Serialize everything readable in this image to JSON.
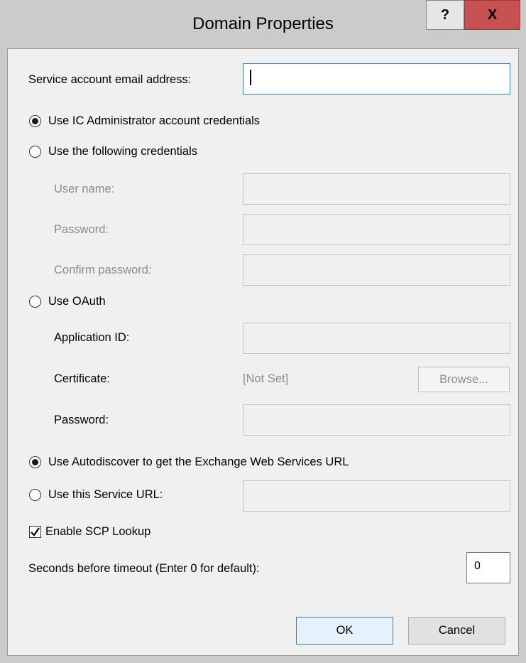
{
  "window": {
    "title": "Domain Properties",
    "help_label": "?",
    "close_label": "X"
  },
  "service_account": {
    "label": "Service account email address:",
    "value": ""
  },
  "credentials": {
    "ic_admin_label": "Use IC Administrator account credentials",
    "ic_admin_selected": true,
    "following_label": "Use the following credentials",
    "username_label": "User name:",
    "password_label": "Password:",
    "confirm_label": "Confirm password:"
  },
  "oauth": {
    "label": "Use OAuth",
    "app_id_label": "Application ID:",
    "certificate_label": "Certificate:",
    "certificate_value": "[Not Set]",
    "browse_label": "Browse...",
    "password_label": "Password:"
  },
  "ews": {
    "autodiscover_label": "Use Autodiscover to get the Exchange Web Services URL",
    "autodiscover_selected": true,
    "service_url_label": "Use this Service URL:"
  },
  "scp": {
    "label": "Enable SCP Lookup",
    "checked": true
  },
  "timeout": {
    "label": "Seconds before timeout (Enter 0 for default):",
    "value": "0"
  },
  "buttons": {
    "ok": "OK",
    "cancel": "Cancel"
  },
  "colors": {
    "close_button": "#c75050",
    "focus_border": "#3c7fb1",
    "disabled_text": "#8c8c8c"
  }
}
